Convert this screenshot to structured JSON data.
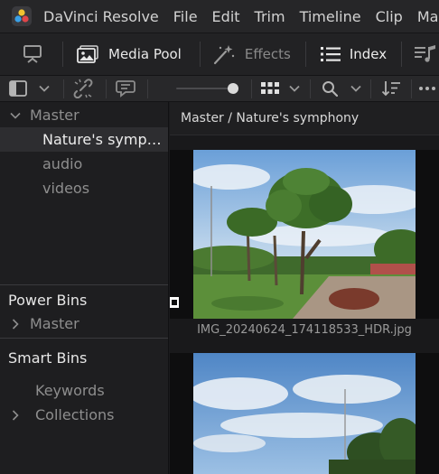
{
  "menubar": {
    "app_name": "DaVinci Resolve",
    "items": [
      "File",
      "Edit",
      "Trim",
      "Timeline",
      "Clip",
      "Mar"
    ]
  },
  "toolbar": {
    "media_pool_label": "Media Pool",
    "effects_label": "Effects",
    "index_label": "Index"
  },
  "sidebar": {
    "master_label": "Master",
    "bins": [
      "Nature's symp…",
      "audio",
      "videos"
    ],
    "power_bins_title": "Power Bins",
    "power_bins_master_label": "Master",
    "smart_bins_title": "Smart Bins",
    "smart_bins_items": [
      "Keywords",
      "Collections"
    ]
  },
  "content": {
    "breadcrumb": "Master / Nature's symphony",
    "clips": [
      {
        "filename": "IMG_20240624_174118533_HDR.jpg"
      }
    ]
  },
  "colors": {
    "text_primary": "#d2d2d2",
    "text_secondary": "#8e8e8e",
    "selected_row": "#2d2d30",
    "background": "#1b1b1d"
  }
}
